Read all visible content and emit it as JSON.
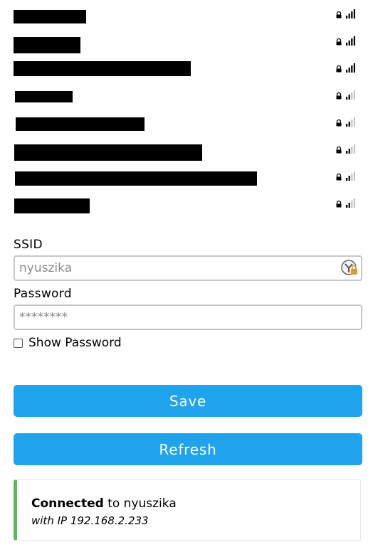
{
  "networks": [
    {
      "name": "",
      "secured": true,
      "signal_bars": 4
    },
    {
      "name": "",
      "secured": true,
      "signal_bars": 4
    },
    {
      "name": "",
      "secured": true,
      "signal_bars": 4
    },
    {
      "name": "",
      "secured": true,
      "signal_bars": 2
    },
    {
      "name": "",
      "secured": true,
      "signal_bars": 2
    },
    {
      "name": "",
      "secured": true,
      "signal_bars": 2
    },
    {
      "name": "",
      "secured": true,
      "signal_bars": 2
    },
    {
      "name": "",
      "secured": true,
      "signal_bars": 2
    }
  ],
  "form": {
    "ssid_label": "SSID",
    "ssid_placeholder": "nyuszika",
    "password_label": "Password",
    "password_placeholder": "********",
    "show_password_label": "Show Password"
  },
  "buttons": {
    "save": "Save",
    "refresh": "Refresh"
  },
  "status": {
    "connected_word": "Connected",
    "to_text": " to nyuszika",
    "ip_text": "with IP 192.168.2.233"
  },
  "colors": {
    "button": "#1fa3ec",
    "status_accent": "#5cb85c"
  }
}
